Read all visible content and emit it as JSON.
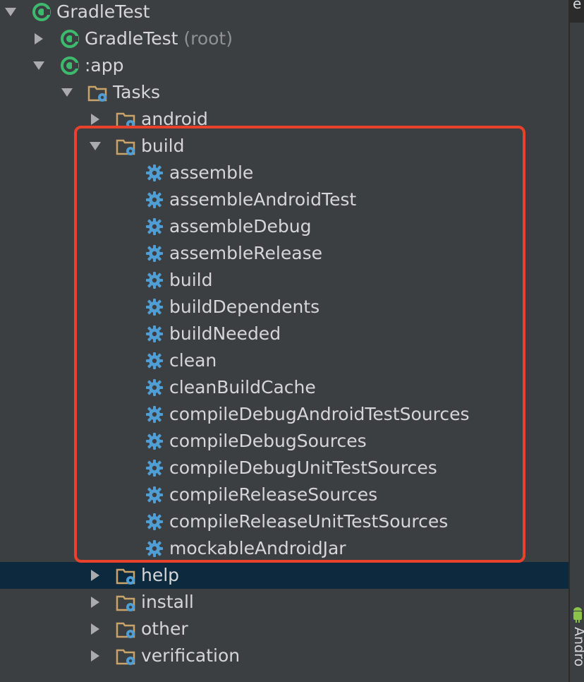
{
  "tree": {
    "root": {
      "label": "GradleTest",
      "icon": "gradle-icon"
    },
    "root_project": {
      "label": "GradleTest",
      "suffix": "(root)",
      "icon": "gradle-icon"
    },
    "app_module": {
      "label": ":app",
      "icon": "gradle-icon"
    },
    "tasks_folder": {
      "label": "Tasks",
      "icon": "folder-gear-icon"
    },
    "groups": {
      "android": {
        "label": "android"
      },
      "build": {
        "label": "build"
      },
      "help": {
        "label": "help"
      },
      "install": {
        "label": "install"
      },
      "other": {
        "label": "other"
      },
      "verification": {
        "label": "verification"
      }
    },
    "build_tasks": [
      "assemble",
      "assembleAndroidTest",
      "assembleDebug",
      "assembleRelease",
      "build",
      "buildDependents",
      "buildNeeded",
      "clean",
      "cleanBuildCache",
      "compileDebugAndroidTestSources",
      "compileDebugSources",
      "compileDebugUnitTestSources",
      "compileReleaseSources",
      "compileReleaseUnitTestSources",
      "mockableAndroidJar"
    ],
    "selected_row": "help"
  },
  "right_strip": {
    "top_tab_text": "e",
    "side_label": "Andro"
  },
  "colors": {
    "background": "#3c3f41",
    "text": "#d4d6d8",
    "muted": "#8f9294",
    "selection": "#0d293e",
    "highlight_border": "#e8412c",
    "gear": "#4f9fd6",
    "folder": "#c9a36a",
    "gradle_green": "#3dba6e"
  }
}
